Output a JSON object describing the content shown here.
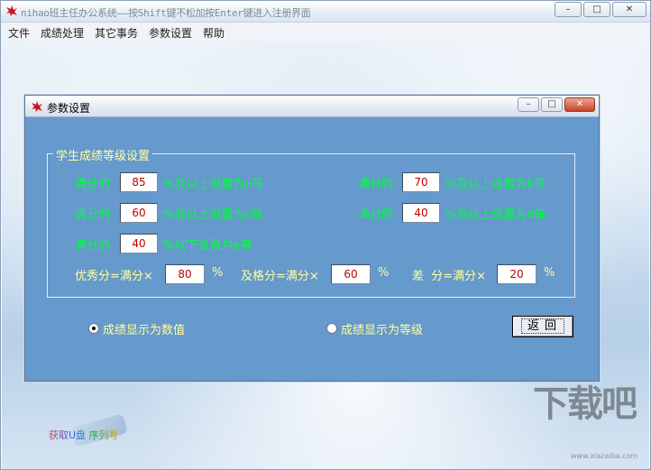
{
  "window": {
    "title": "nihao班主任办公系统——按Shift键不松加按Enter键进入注册界面",
    "controls": {
      "minimize": "–",
      "maximize": "□",
      "close": "✕"
    }
  },
  "menu": [
    "文件",
    "成绩处理",
    "其它事务",
    "参数设置",
    "帮助"
  ],
  "dialog": {
    "title": "参数设置",
    "group": {
      "legend": "学生成绩等级设置",
      "rows": [
        {
          "prefix": "满分的",
          "value": "85",
          "suffix": "%及以上设置为a等"
        },
        {
          "prefix": "满分的",
          "value": "70",
          "suffix": "%及以上设置为b等"
        },
        {
          "prefix": "满分的",
          "value": "60",
          "suffix": "%及以上设置为c等"
        },
        {
          "prefix": "满分的",
          "value": "40",
          "suffix": "%及以上设置为d等"
        },
        {
          "prefix": "满分的",
          "value": "40",
          "suffix": "%以下设置为e等"
        }
      ],
      "thresholds": [
        {
          "label": "优秀分=满分×",
          "value": "80",
          "unit": "%"
        },
        {
          "label": "及格分=满分×",
          "value": "60",
          "unit": "%"
        },
        {
          "label": "差  分=满分×",
          "value": "20",
          "unit": "%"
        }
      ]
    },
    "display_options": [
      {
        "label": "成绩显示为数值",
        "selected": true
      },
      {
        "label": "成绩显示为等级",
        "selected": false
      }
    ],
    "back_button": "返回"
  },
  "background": {
    "usb_text": "获取U盘  序列号",
    "watermark": "下载吧",
    "watermark_url": "www.xiazaiba.com"
  },
  "colors": {
    "dialog_bg": "#6699cc",
    "label_green": "#00ff40",
    "label_yellow": "#ffffa0",
    "value_red": "#c00000"
  }
}
